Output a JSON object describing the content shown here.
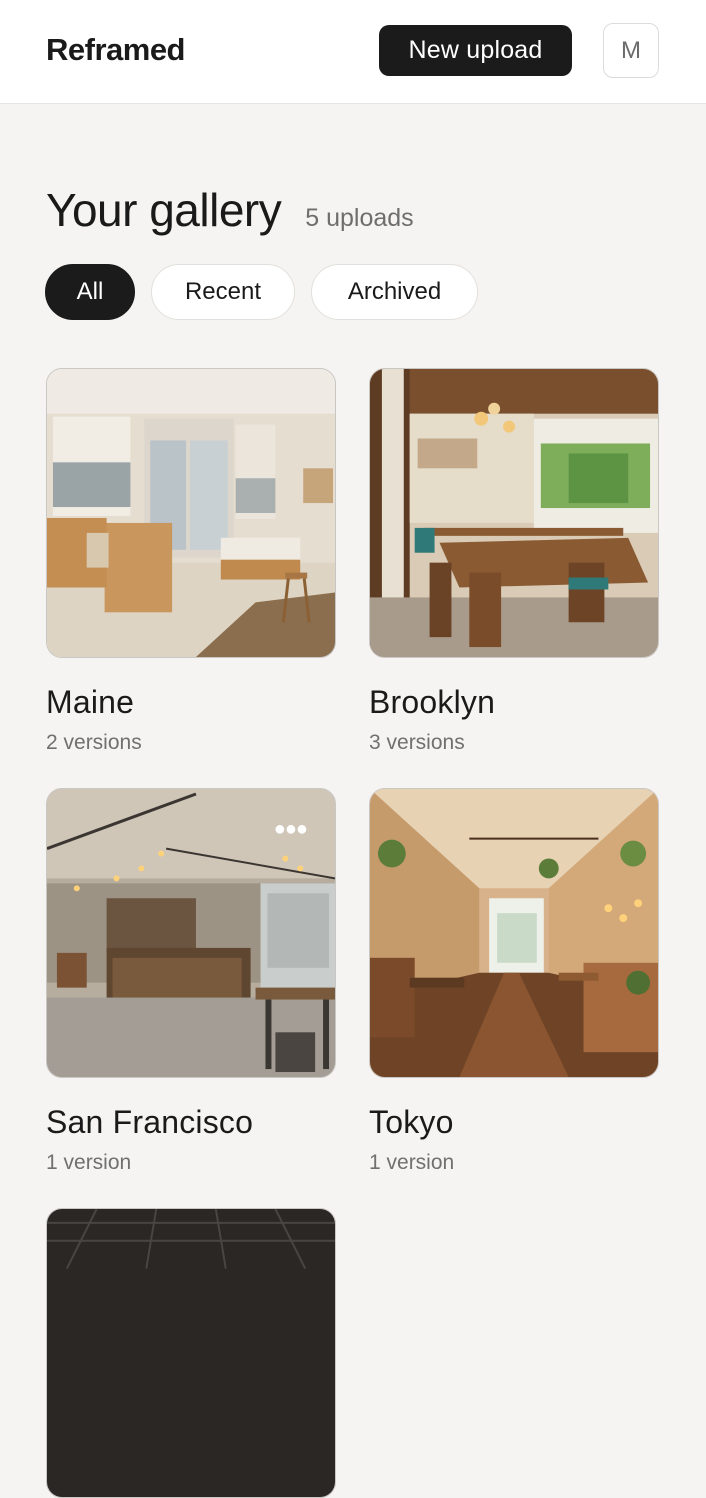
{
  "header": {
    "brand": "Reframed",
    "new_upload_label": "New upload",
    "avatar_initial": "M"
  },
  "gallery": {
    "title": "Your gallery",
    "count_label": "5 uploads"
  },
  "filters": [
    {
      "label": "All",
      "active": true
    },
    {
      "label": "Recent",
      "active": false
    },
    {
      "label": "Archived",
      "active": false
    }
  ],
  "cards": [
    {
      "title": "Maine",
      "subtitle": "2 versions",
      "scene": "bright-office-storefront"
    },
    {
      "title": "Brooklyn",
      "subtitle": "3 versions",
      "scene": "wood-cafe-pendant-lights"
    },
    {
      "title": "San Francisco",
      "subtitle": "1 version",
      "scene": "industrial-cafe-bulbs",
      "more_icon": "more-dots-icon"
    },
    {
      "title": "Tokyo",
      "subtitle": "1 version",
      "scene": "long-plant-cafe"
    },
    {
      "title": "",
      "subtitle": "",
      "scene": "dark-grid-ceiling"
    }
  ]
}
